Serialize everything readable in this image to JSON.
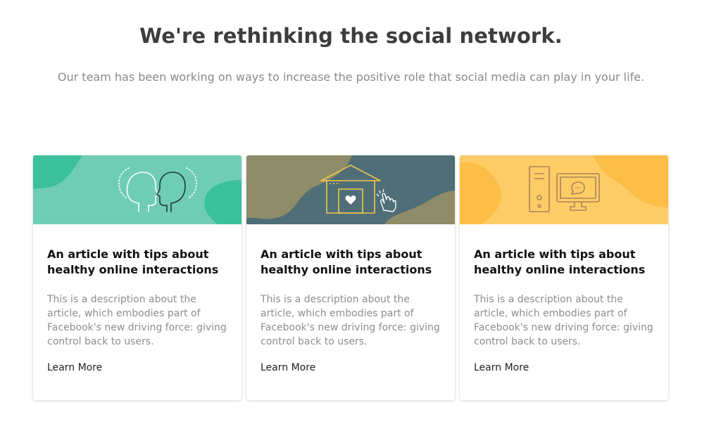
{
  "header": {
    "title": "We're rethinking the social network.",
    "subtitle": "Our team has been working on ways to increase the positive role that social media can play in your life."
  },
  "cards": [
    {
      "title": "An article with tips about healthy online interactions",
      "description": "This is a description about the article, which embodies part of Facebook's new driving force: giving control back to users.",
      "link_label": "Learn More",
      "illustration": "two-heads-icon",
      "colors": {
        "bg": "#6fcdb5",
        "blob": "#3bc19a",
        "line": "#ffffff",
        "line2": "#1d3b30"
      }
    },
    {
      "title": "An article with tips about healthy online interactions",
      "description": "This is a description about the article, which embodies part of Facebook's new driving force: giving control back to users.",
      "link_label": "Learn More",
      "illustration": "house-heart-icon",
      "colors": {
        "bg": "#4f6e77",
        "blob": "#8e8c69",
        "line": "#f3c74d",
        "line2": "#ffffff"
      }
    },
    {
      "title": "An article with tips about healthy online interactions",
      "description": "This is a description about the article, which embodies part of Facebook's new driving force: giving control back to users.",
      "link_label": "Learn More",
      "illustration": "computer-chat-icon",
      "colors": {
        "bg": "#ffcc66",
        "blob": "#fdbe47",
        "line": "#a7855a",
        "line2": "#a7855a"
      }
    }
  ]
}
